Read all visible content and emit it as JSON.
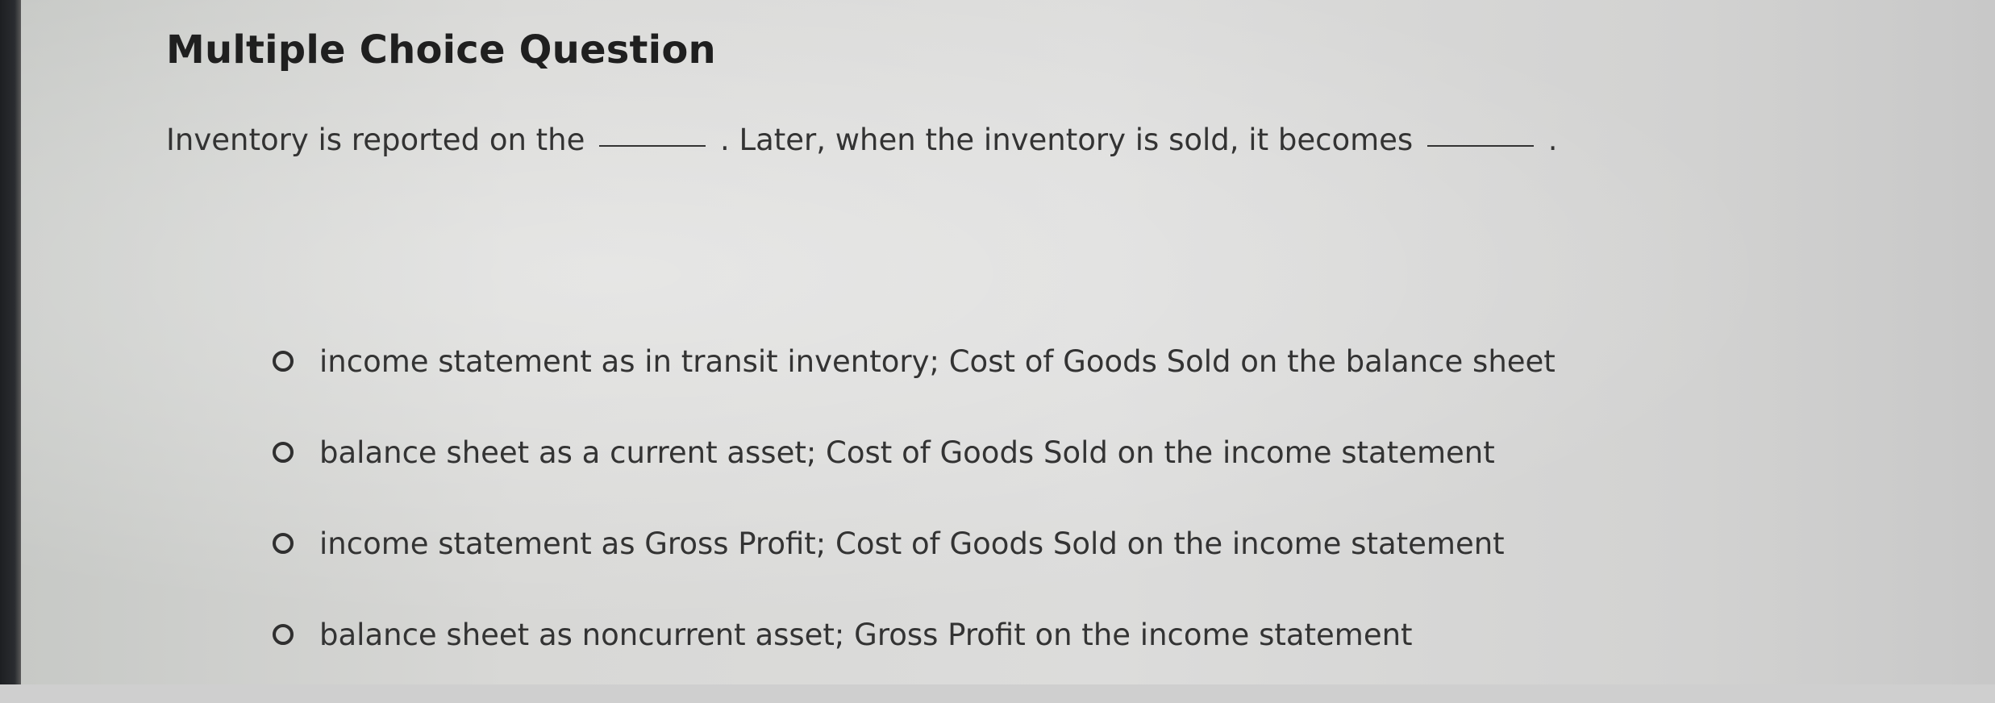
{
  "title": "Multiple Choice Question",
  "question": {
    "part1": "Inventory is reported on the",
    "part2": ". Later, when the inventory is sold, it becomes",
    "part3": "."
  },
  "options": [
    {
      "label": "income statement as in transit inventory; Cost of Goods Sold on the balance sheet",
      "selected": false
    },
    {
      "label": "balance sheet as a current asset; Cost of Goods Sold on the income statement",
      "selected": false
    },
    {
      "label": "income statement as Gross Profit; Cost of Goods Sold on the income statement",
      "selected": false
    },
    {
      "label": "balance sheet as noncurrent asset; Gross Profit on the income statement",
      "selected": false
    }
  ]
}
